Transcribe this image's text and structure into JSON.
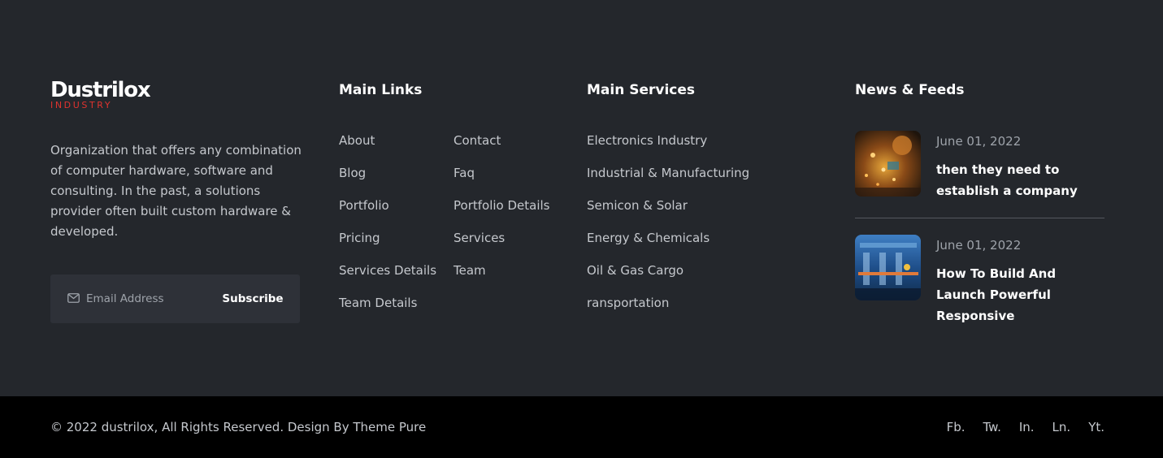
{
  "brand": {
    "name": "Dustrilox",
    "tagline": "INDUSTRY"
  },
  "about": {
    "text": "Organization that offers any combination of computer hardware, software and consulting. In the past, a solutions provider often built custom hardware & developed."
  },
  "subscribe": {
    "placeholder": "Email Address",
    "button_label": "Subscribe",
    "icon": "mail-icon"
  },
  "main_links": {
    "title": "Main Links",
    "column_1": [
      "About",
      "Blog",
      "Portfolio",
      "Pricing",
      "Services Details",
      "Team Details"
    ],
    "column_2": [
      "Contact",
      "Faq",
      "Portfolio Details",
      "Services",
      "Team"
    ]
  },
  "main_services": {
    "title": "Main Services",
    "items": [
      "Electronics Industry",
      "Industrial & Manufacturing",
      "Semicon & Solar",
      "Energy & Chemicals",
      "Oil & Gas Cargo",
      "ransportation"
    ]
  },
  "news": {
    "title": "News & Feeds",
    "items": [
      {
        "date": "June 01, 2022",
        "title": "then they need to establish a company"
      },
      {
        "date": "June 01, 2022",
        "title": "How To Build And Launch Powerful Responsive"
      }
    ]
  },
  "footer_bottom": {
    "copyright": "© 2022 dustrilox, All Rights Reserved. Design By Theme Pure",
    "socials": [
      "Fb.",
      "Tw.",
      "In.",
      "Ln.",
      "Yt."
    ]
  },
  "colors": {
    "background": "#24272c",
    "bottom_bar": "#000000",
    "accent": "#e0332f",
    "input_bg": "#2e3138"
  }
}
